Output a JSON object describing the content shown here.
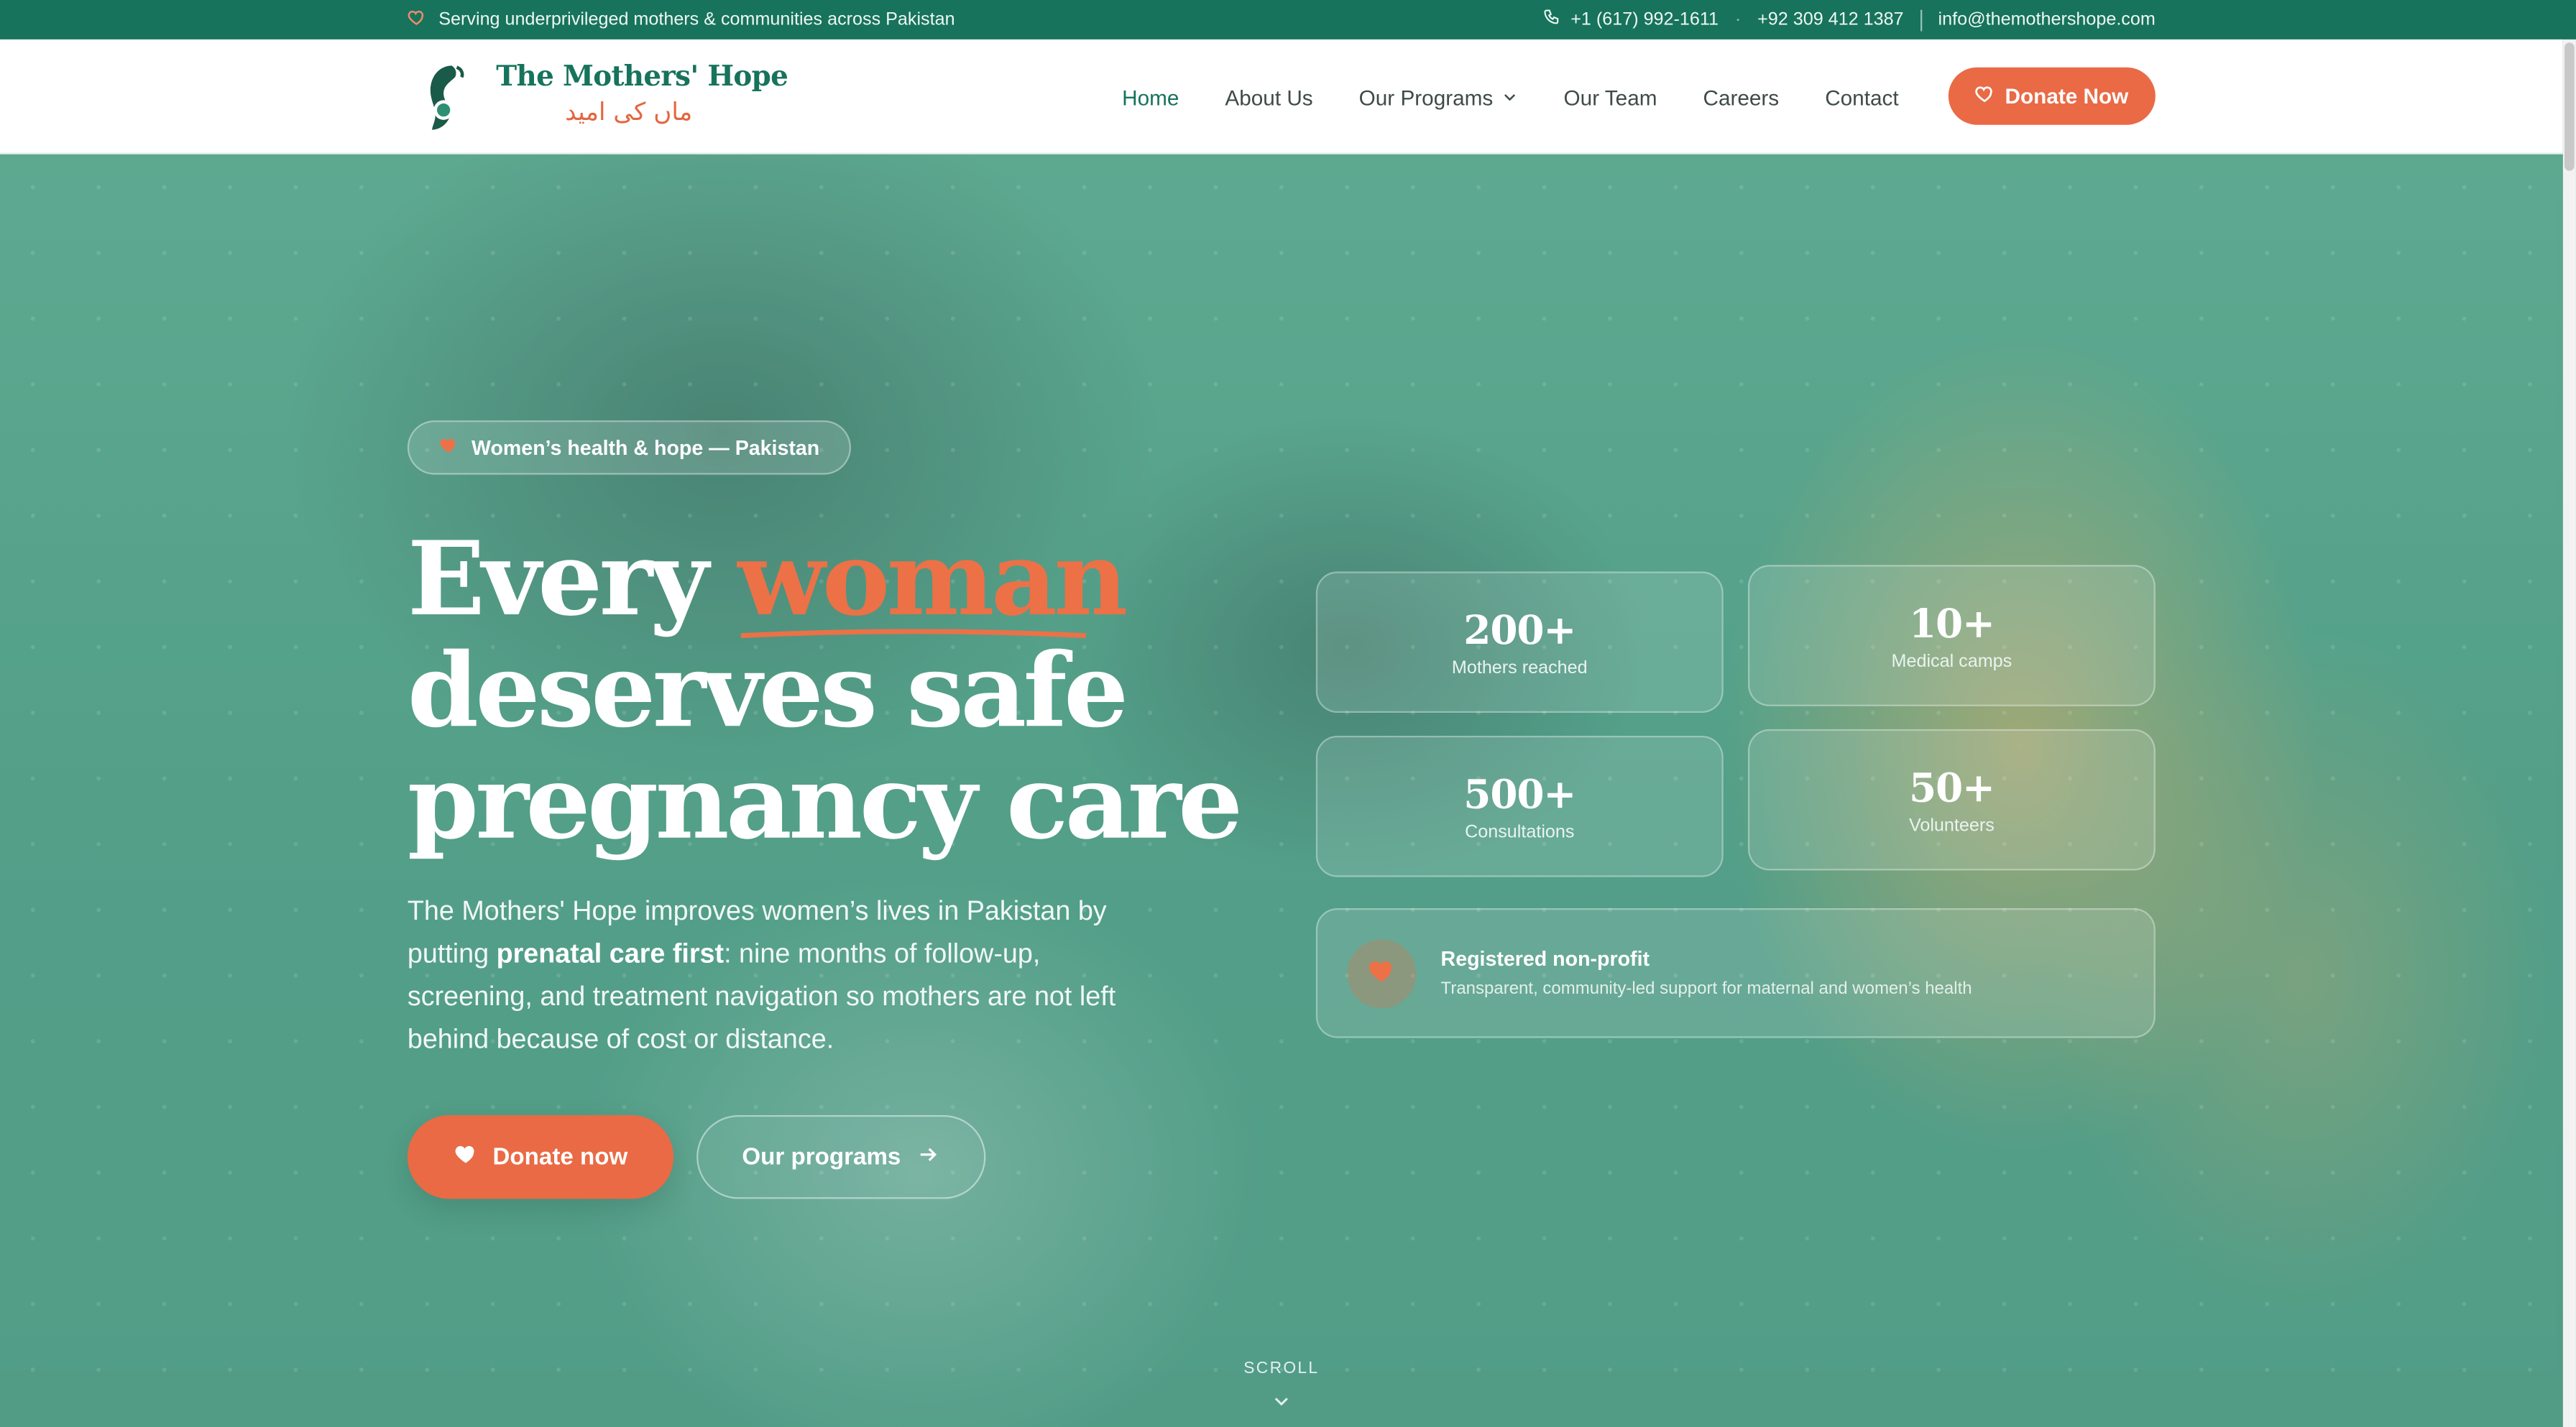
{
  "topbar": {
    "tagline": "Serving underprivileged mothers & communities across Pakistan",
    "phone_us": "+1 (617) 992-1611",
    "separator": "·",
    "phone_pk": "+92 309 412 1387",
    "email": "info@themothershope.com"
  },
  "nav": {
    "logo_name": "The Mothers' Hope",
    "logo_urdu": "ماں کی امید",
    "items": [
      {
        "label": "Home",
        "active": true
      },
      {
        "label": "About Us"
      },
      {
        "label": "Our Programs",
        "has_dropdown": true
      },
      {
        "label": "Our Team"
      },
      {
        "label": "Careers"
      },
      {
        "label": "Contact"
      }
    ],
    "donate_label": "Donate Now"
  },
  "hero": {
    "pill": "Women’s health & hope — Pakistan",
    "headline": {
      "part1": "Every ",
      "accent": "woman",
      "line2": "deserves safe",
      "line3": "pregnancy care"
    },
    "desc": {
      "before": "The Mothers' Hope improves women’s lives in Pakistan by putting ",
      "bold": "prenatal care first",
      "after": ": nine months of follow-up, screening, and treatment navigation so mothers are not left behind because of cost or distance."
    },
    "donate_label": "Donate now",
    "programs_label": "Our programs",
    "stats": [
      {
        "num": "200+",
        "label": "Mothers reached"
      },
      {
        "num": "10+",
        "label": "Medical camps"
      },
      {
        "num": "500+",
        "label": "Consultations"
      },
      {
        "num": "50+",
        "label": "Volunteers"
      }
    ],
    "nonprofit": {
      "title": "Registered non-profit",
      "subtitle": "Transparent, community-led support for maternal and women’s health"
    },
    "scroll_label": "SCROLL"
  },
  "colors": {
    "brand_green": "#17735c",
    "accent_orange": "#e96a45",
    "hero_green": "#2f8f73"
  }
}
